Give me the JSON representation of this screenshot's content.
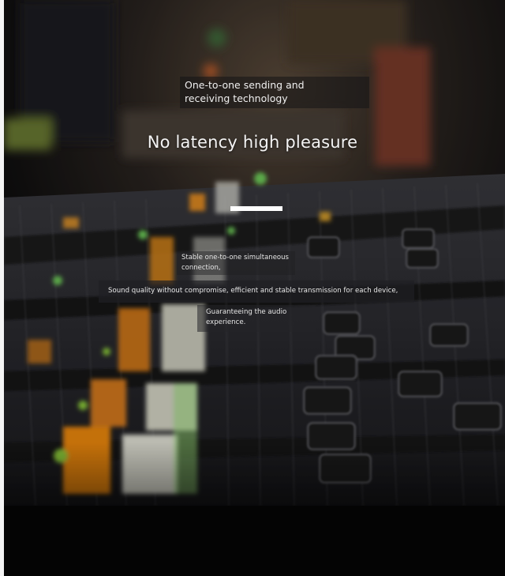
{
  "feature": {
    "subtitle_line1": "One-to-one sending and",
    "subtitle_line2": "receiving technology",
    "headline": "No latency high pleasure",
    "detail_line1": "Stable one-to-one simultaneous",
    "detail_line2": "connection,",
    "detail_line3": "Sound quality without compromise, efficient and stable transmission for each device,",
    "detail_line4": "Guaranteeing the audio",
    "detail_line5": "experience."
  },
  "colors": {
    "text": "#f4f4f4",
    "accent_bar": "#ffffff",
    "background": "#0a0a0b"
  }
}
